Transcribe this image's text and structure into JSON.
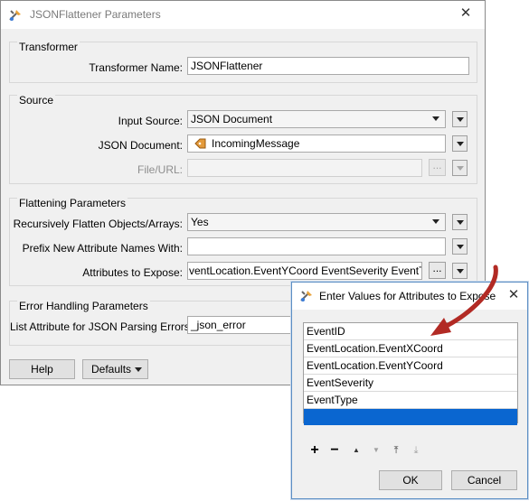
{
  "main_window": {
    "title": "JSONFlattener Parameters",
    "sections": {
      "transformer": "Transformer",
      "source": "Source",
      "flattening": "Flattening Parameters",
      "error_handling": "Error Handling Parameters"
    },
    "fields": {
      "transformer_name": {
        "label": "Transformer Name:",
        "value": "JSONFlattener"
      },
      "input_source": {
        "label": "Input Source:",
        "value": "JSON Document"
      },
      "json_document": {
        "label": "JSON Document:",
        "value": "IncomingMessage"
      },
      "file_url": {
        "label": "File/URL:",
        "value": ""
      },
      "recursively_flatten": {
        "label": "Recursively Flatten Objects/Arrays:",
        "value": "Yes"
      },
      "prefix": {
        "label": "Prefix New Attribute Names With:",
        "value": ""
      },
      "attributes_to_expose": {
        "label": "Attributes to Expose:",
        "value": "ventLocation.EventYCoord EventSeverity EventType"
      },
      "list_attribute": {
        "label": "List Attribute for JSON Parsing Errors:",
        "value": "_json_error"
      }
    },
    "buttons": {
      "help": "Help",
      "defaults": "Defaults",
      "dots": "..."
    }
  },
  "values_dialog": {
    "title": "Enter Values for Attributes to Expose",
    "items": [
      "EventID",
      "EventLocation.EventXCoord",
      "EventLocation.EventYCoord",
      "EventSeverity",
      "EventType",
      ""
    ],
    "toolbar": {
      "add": "+",
      "remove": "−",
      "move_up": "▲",
      "move_down": "▼",
      "move_top": "⤒",
      "move_bottom": "⤓"
    },
    "ok": "OK",
    "cancel": "Cancel"
  },
  "colors": {
    "selection": "#0a66d0",
    "arrow": "#b22a24"
  }
}
